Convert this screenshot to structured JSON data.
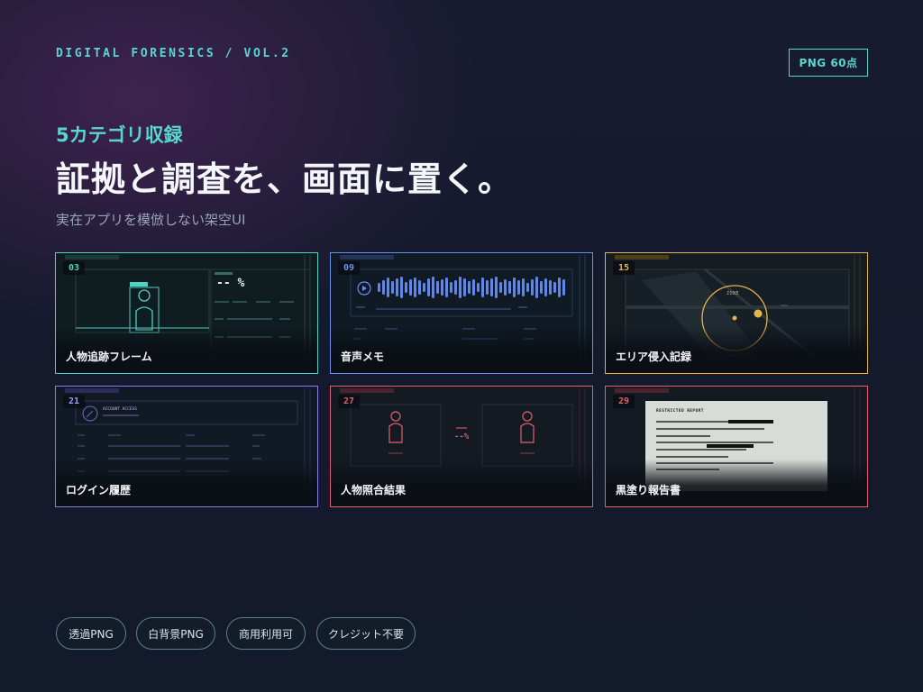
{
  "header": {
    "kicker": "DIGITAL FORENSICS / VOL.2",
    "count_badge": "PNG 60点"
  },
  "hero": {
    "subtitle": "5カテゴリ収録",
    "title": "証拠と調査を、画面に置く。",
    "tagline": "実在アプリを模倣しない架空UI"
  },
  "cards": [
    {
      "num": "03",
      "label": "人物追跡フレーム",
      "color": "#4fd1c5",
      "preview_value": "-- %"
    },
    {
      "num": "09",
      "label": "音声メモ",
      "color": "#6a8ff0"
    },
    {
      "num": "15",
      "label": "エリア侵入記録",
      "color": "#e7b34a",
      "preview_text": "ZONE"
    },
    {
      "num": "21",
      "label": "ログイン履歴",
      "color": "#8a7bf0",
      "preview_title": "ACCOUNT ACCESS"
    },
    {
      "num": "27",
      "label": "人物照合結果",
      "color": "#e0606e",
      "preview_value": "--%"
    },
    {
      "num": "29",
      "label": "黒塗り報告書",
      "color": "#e0606e",
      "preview_title": "RESTRICTED REPORT"
    }
  ],
  "chips": [
    "透過PNG",
    "白背景PNG",
    "商用利用可",
    "クレジット不要"
  ],
  "colors": {
    "accent": "#5ad6d0",
    "background": "#151a2d"
  }
}
